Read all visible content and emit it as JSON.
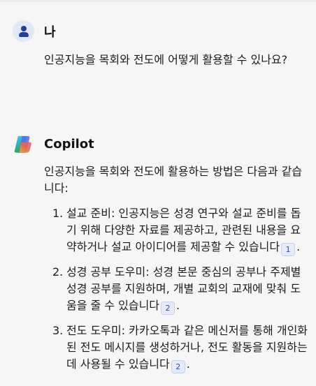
{
  "user_message": {
    "sender": "나",
    "text": "인공지능을 목회와 전도에 어떻게 활용할 수 있나요?"
  },
  "copilot_message": {
    "sender": "Copilot",
    "intro": "인공지능을 목회와 전도에 활용하는 방법은 다음과 같습니다:",
    "items": [
      {
        "number": "1.",
        "text": "설교 준비: 인공지능은 성경 연구와 설교 준비를 돕기 위해 다양한 자료를 제공하고, 관련된 내용을 요약하거나 설교 아이디어를 제공할 수 있습니다",
        "citation": "1",
        "end": "."
      },
      {
        "number": "2.",
        "text": "성경 공부 도우미: 성경 본문 중심의 공부나 주제별 성경 공부를 지원하며, 개별 교회의 교재에 맞춰 도움을 줄 수 있습니다",
        "citation": "2",
        "end": "."
      },
      {
        "number": "3.",
        "text": "전도 도우미: 카카오톡과 같은 메신저를 통해 개인화된 전도 메시지를 생성하거나, 전도 활동을 지원하는 데 사용될 수 있습니다",
        "citation": "2",
        "end": "."
      }
    ]
  },
  "icons": {
    "user_avatar": "user-avatar-icon",
    "copilot_logo": "copilot-logo-icon"
  },
  "colors": {
    "background": "#f6f6f6",
    "avatar_bg": "#e3e8f7",
    "avatar_fg": "#1f3f9e",
    "citation": "#2c4bb3"
  }
}
